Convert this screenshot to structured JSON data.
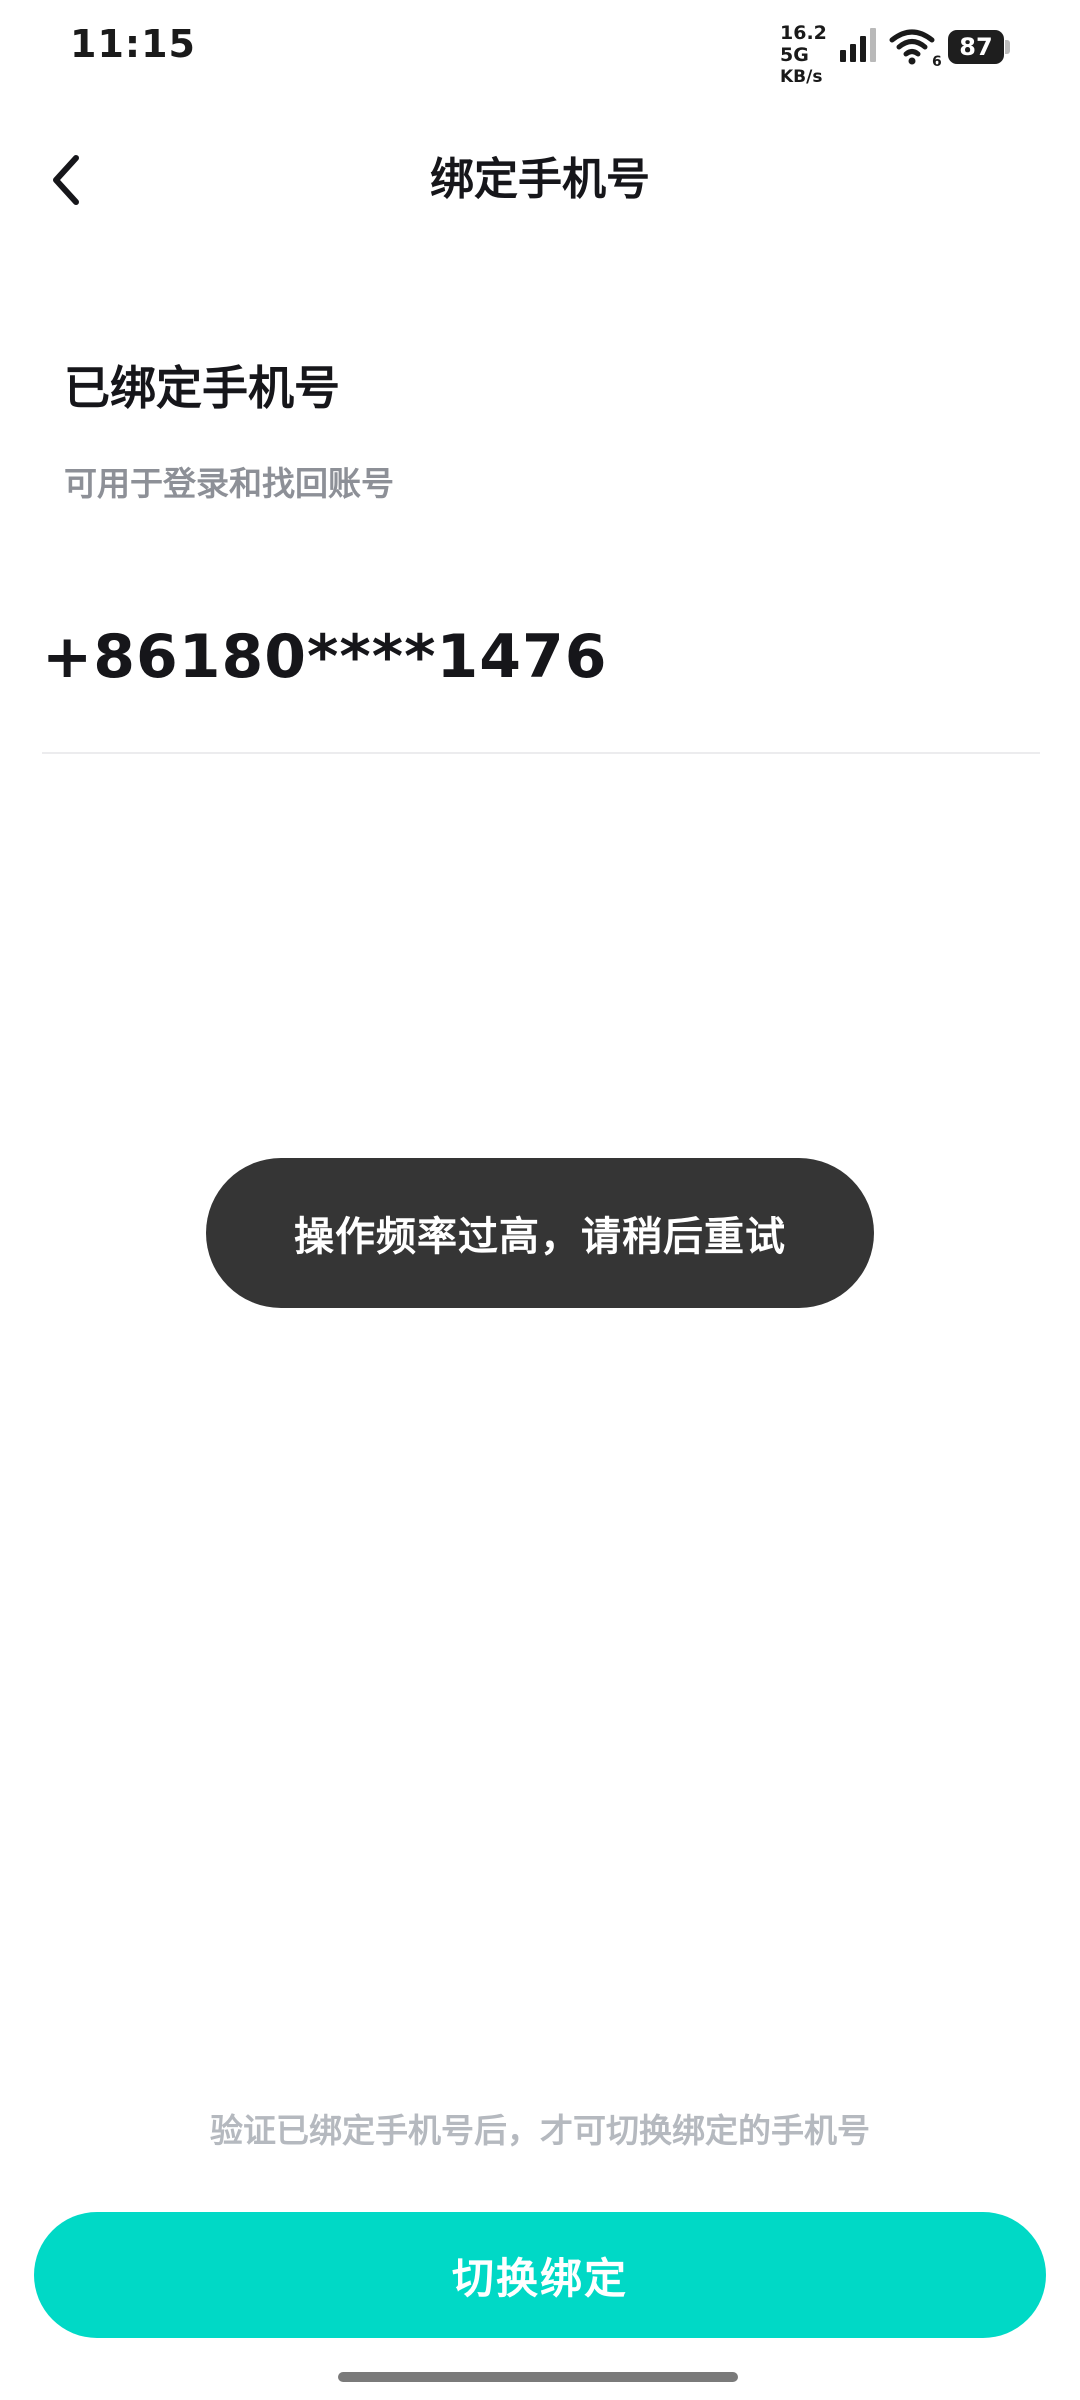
{
  "status_bar": {
    "time": "11:15",
    "net_speed_value": "16.2 5G",
    "net_speed_unit": "KB/s",
    "wifi_badge": "6",
    "battery_level": "87",
    "icons": [
      "signal-icon",
      "wifi-icon",
      "battery-icon"
    ]
  },
  "nav": {
    "title": "绑定手机号",
    "back_icon": "chevron-left-icon"
  },
  "bound_section": {
    "heading": "已绑定手机号",
    "subtext": "可用于登录和找回账号",
    "phone": "+86180****1476"
  },
  "toast": {
    "message": "操作频率过高，请稍后重试"
  },
  "footer": {
    "hint": "验证已绑定手机号后，才可切换绑定的手机号",
    "button_label": "切换绑定"
  },
  "colors": {
    "accent": "#00d9c6",
    "toast_bg": "#353535",
    "subtext": "#8d9097",
    "hint": "#b5b9bf"
  }
}
